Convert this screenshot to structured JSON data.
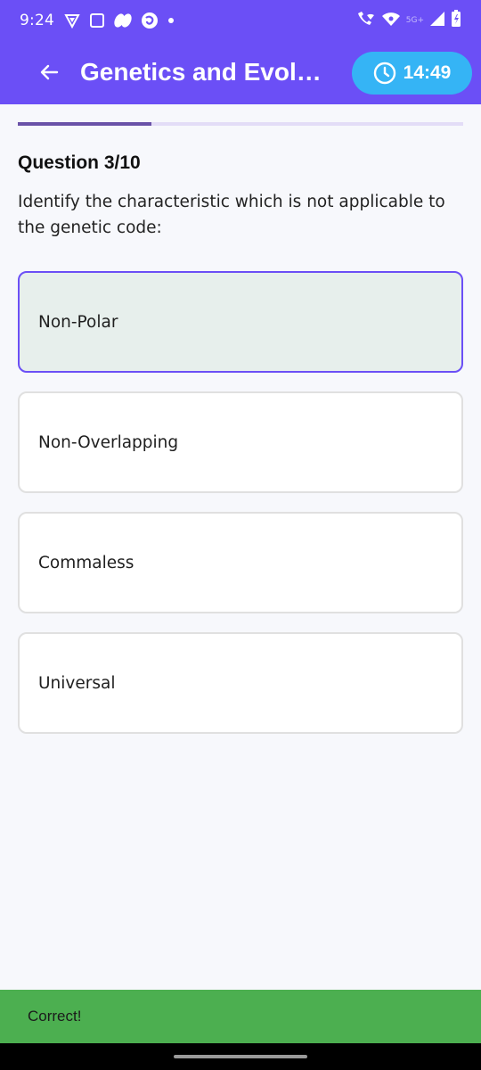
{
  "status_bar": {
    "time": "9:24",
    "network_label": "5G+",
    "left_icons": [
      "shield-icon",
      "square-icon",
      "leaf-icon",
      "app-icon",
      "dot-icon"
    ],
    "right_icons": [
      "wifi-call-icon",
      "wifi-icon",
      "signal-icon",
      "battery-icon"
    ]
  },
  "app_bar": {
    "back_icon": "arrow-left-icon",
    "title": "Genetics and Evolution",
    "timer": {
      "icon": "clock-icon",
      "text": "14:49"
    }
  },
  "progress": {
    "current": 3,
    "total": 10,
    "fraction": 0.3
  },
  "question": {
    "number_label": "Question 3/10",
    "text": "Identify the characteristic which is not applicable to the genetic code:"
  },
  "options": [
    {
      "label": "Non-Polar",
      "selected": true
    },
    {
      "label": "Non-Overlapping",
      "selected": false
    },
    {
      "label": "Commaless",
      "selected": false
    },
    {
      "label": "Universal",
      "selected": false
    }
  ],
  "snackbar": {
    "text": "Correct!"
  },
  "colors": {
    "primary": "#6b4ff6",
    "timer_bg": "#35b4f5",
    "progress_fill": "#6a52a8",
    "progress_track": "#e3ddf7",
    "selected_option_bg": "#e7efec",
    "snackbar_bg": "#4caf50"
  }
}
